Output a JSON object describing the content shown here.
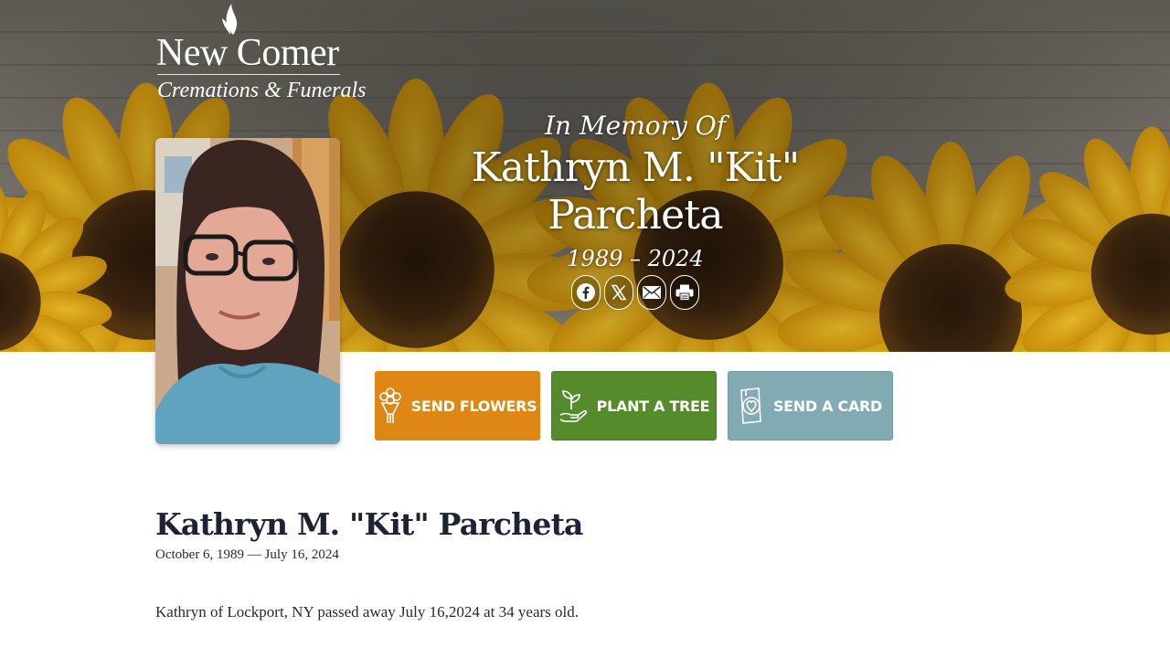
{
  "brand": {
    "name": "New Comer",
    "tagline": "Cremations & Funerals"
  },
  "memorial": {
    "prefix": "In Memory Of",
    "name": "Kathryn M. \"Kit\" Parcheta",
    "years": "1989 – 2024"
  },
  "share": [
    {
      "icon": "facebook-icon"
    },
    {
      "icon": "x-icon"
    },
    {
      "icon": "email-icon"
    },
    {
      "icon": "print-icon"
    }
  ],
  "actions": {
    "send_flowers": "SEND FLOWERS",
    "plant_tree": "PLANT A TREE",
    "send_card": "SEND A CARD"
  },
  "obituary": {
    "name": "Kathryn M. \"Kit\" Parcheta",
    "dates": "October 6, 1989 — July 16, 2024",
    "body": "Kathryn of Lockport, NY passed away July 16,2024 at 34 years old."
  },
  "colors": {
    "flowers": "#de8714",
    "tree": "#558b2b",
    "card": "#82aab2",
    "heading": "#1e2235"
  }
}
